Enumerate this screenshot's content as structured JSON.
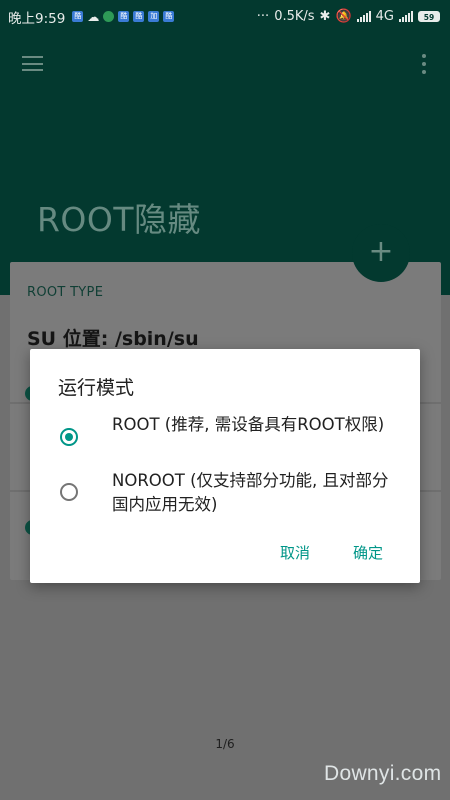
{
  "status_bar": {
    "time": "晚上9:59",
    "notif_glyph": "酷",
    "notif_glyph_2": "加",
    "speed": "0.5K/s",
    "network": "4G",
    "battery": "59",
    "dots": "···"
  },
  "app": {
    "title": "ROOT隐藏",
    "card_label": "ROOT TYPE",
    "su_location": "SU 位置: /sbin/su",
    "fab_icon": "+"
  },
  "dialog": {
    "title": "运行模式",
    "options": [
      {
        "label": "ROOT (推荐, 需设备具有ROOT权限)",
        "checked": true
      },
      {
        "label": "NOROOT (仅支持部分功能, 且对部分国内应用无效)",
        "checked": false
      }
    ],
    "cancel_label": "取消",
    "ok_label": "确定"
  },
  "page_indicator": "1/6",
  "watermark": "Downyi.com",
  "colors": {
    "primary_dark": "#03392f",
    "accent": "#009688"
  }
}
